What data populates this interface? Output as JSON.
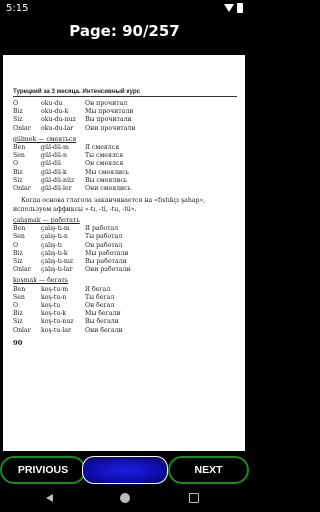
{
  "status": {
    "time": "5:15",
    "wifi_icon": "wifi-icon",
    "battery_icon": "battery-icon"
  },
  "viewer": {
    "page_label": "Page: 90/257"
  },
  "book": {
    "header": "Турецкий за 3 месяца. Интенсивный курс",
    "rows_a": [
      [
        "O",
        "oku-du",
        "Он прочитал"
      ],
      [
        "Biz",
        "oku-du-k",
        "Мы прочитали"
      ],
      [
        "Siz",
        "oku-du-nuz",
        "Вы прочитали"
      ],
      [
        "Onlar",
        "oku-du-lar",
        "Они прочитали"
      ]
    ],
    "verb_b": "gülmek — смеяться",
    "rows_b": [
      [
        "Ben",
        "gül-dü-m",
        "Я смеялся"
      ],
      [
        "Sen",
        "gül-dü-n",
        "Ты смеялся"
      ],
      [
        "O",
        "gül-dü",
        "Он смеялся"
      ],
      [
        "Biz",
        "gül-dü-k",
        "Мы смеялись"
      ],
      [
        "Siz",
        "gül-dü-nüz",
        "Вы смеялись"
      ],
      [
        "Onlar",
        "gül-dü-ler",
        "Они смеялись"
      ]
    ],
    "paragraph": "Когда основа глагола заканчивается на «fıstıkçı şahap», используем аффиксы «-tı, -ti, -tu, -tü».",
    "verb_c": "çalışmak — работать",
    "rows_c": [
      [
        "Ben",
        "çalış-tı-m",
        "Я работал"
      ],
      [
        "Sen",
        "çalış-tı-n",
        "Ты работал"
      ],
      [
        "O",
        "çalış-tı",
        "Он работал"
      ],
      [
        "Biz",
        "çalış-tı-k",
        "Мы работали"
      ],
      [
        "Siz",
        "çalış-tı-nız",
        "Вы работали"
      ],
      [
        "Onlar",
        "çalış-tı-lar",
        "Они работали"
      ]
    ],
    "verb_d": "koşmak — бегать",
    "rows_d": [
      [
        "Ben",
        "koş-tu-m",
        "Я бегал"
      ],
      [
        "Sen",
        "koş-tu-n",
        "Ты бегал"
      ],
      [
        "O",
        "koş-tu",
        "Он бегал"
      ],
      [
        "Biz",
        "koş-tu-k",
        "Мы бегали"
      ],
      [
        "Siz",
        "koş-tu-nuz",
        "Вы бегали"
      ],
      [
        "Onlar",
        "koş-tu-lar",
        "Они бегали"
      ]
    ],
    "page_number": "90"
  },
  "nav": {
    "prev_label": "PRIVIOUS",
    "next_label": "NEXT"
  },
  "system_nav": {
    "back_icon": "back-icon",
    "home_icon": "home-icon",
    "recents_icon": "recents-icon"
  }
}
